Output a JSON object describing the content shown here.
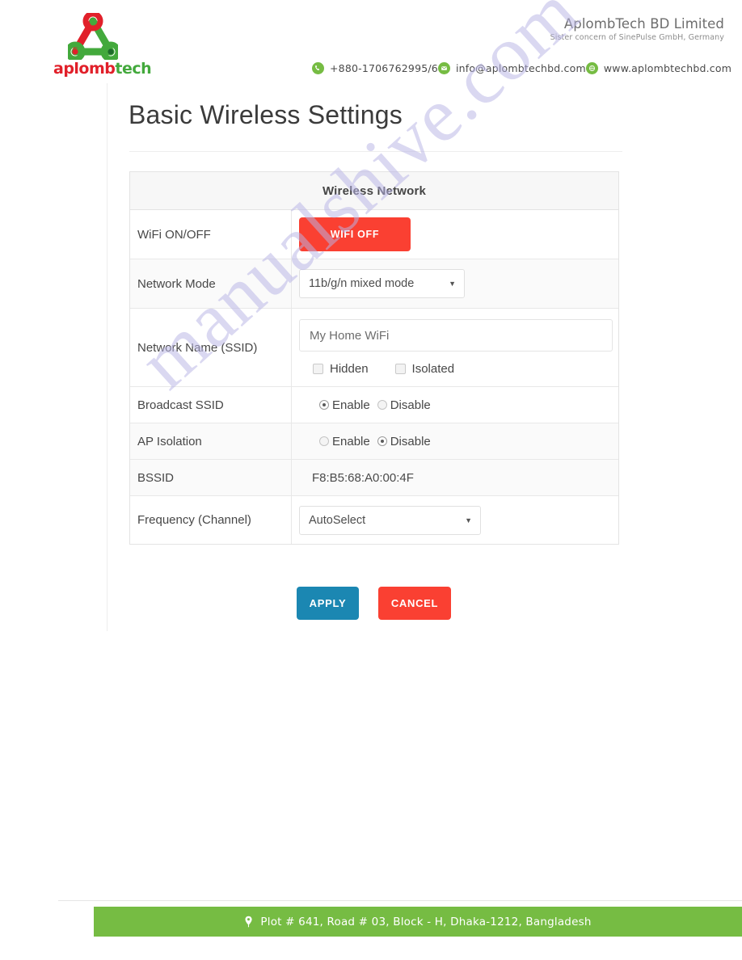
{
  "header": {
    "logo": {
      "icon": "aplombtech-triangle-logo",
      "word_primary": "aplomb",
      "word_secondary": "tech"
    },
    "company_name": "AplombTech BD Limited",
    "company_sub": "Sister concern of SinePulse GmbH, Germany",
    "contacts": [
      {
        "icon": "phone-icon",
        "text": "+880-1706762995/6"
      },
      {
        "icon": "envelope-icon",
        "text": "info@aplombtechbd.com"
      },
      {
        "icon": "globe-icon",
        "text": "www.aplombtechbd.com"
      }
    ]
  },
  "page": {
    "title": "Basic Wireless Settings"
  },
  "table": {
    "header": "Wireless Network",
    "rows": {
      "wifi_toggle": {
        "label": "WiFi ON/OFF",
        "button": "WIFI OFF"
      },
      "network_mode": {
        "label": "Network Mode",
        "value": "11b/g/n mixed mode",
        "caret": "▼"
      },
      "ssid": {
        "label": "Network Name (SSID)",
        "value": "My Home WiFi",
        "placeholder": "My Home WiFi",
        "checkboxes": [
          {
            "label": "Hidden",
            "checked": false
          },
          {
            "label": "Isolated",
            "checked": false
          }
        ]
      },
      "broadcast_ssid": {
        "label": "Broadcast SSID",
        "options": [
          {
            "label": "Enable",
            "selected": true
          },
          {
            "label": "Disable",
            "selected": false
          }
        ]
      },
      "ap_isolation": {
        "label": "AP Isolation",
        "options": [
          {
            "label": "Enable",
            "selected": false
          },
          {
            "label": "Disable",
            "selected": true
          }
        ]
      },
      "bssid": {
        "label": "BSSID",
        "value": "F8:B5:68:A0:00:4F"
      },
      "frequency": {
        "label": "Frequency (Channel)",
        "value": "AutoSelect",
        "caret": "▼"
      }
    }
  },
  "actions": {
    "apply": "APPLY",
    "cancel": "CANCEL"
  },
  "watermark": {
    "text": "manualshive.com"
  },
  "footer": {
    "icon": "location-pin-icon",
    "address": "Plot # 641, Road # 03, Block - H, Dhaka-1212, Bangladesh"
  },
  "colors": {
    "brand_green": "#76bc43",
    "brand_red": "#e1202a",
    "danger": "#fa4032",
    "primary": "#1b87b2"
  }
}
